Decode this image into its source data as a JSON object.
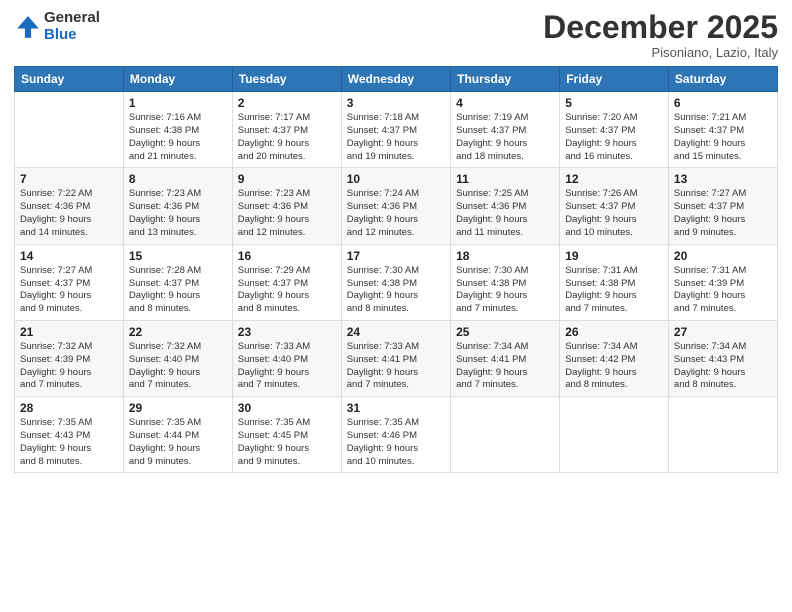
{
  "logo": {
    "general": "General",
    "blue": "Blue"
  },
  "title": "December 2025",
  "location": "Pisoniano, Lazio, Italy",
  "weekdays": [
    "Sunday",
    "Monday",
    "Tuesday",
    "Wednesday",
    "Thursday",
    "Friday",
    "Saturday"
  ],
  "weeks": [
    [
      {
        "day": "",
        "info": ""
      },
      {
        "day": "1",
        "info": "Sunrise: 7:16 AM\nSunset: 4:38 PM\nDaylight: 9 hours\nand 21 minutes."
      },
      {
        "day": "2",
        "info": "Sunrise: 7:17 AM\nSunset: 4:37 PM\nDaylight: 9 hours\nand 20 minutes."
      },
      {
        "day": "3",
        "info": "Sunrise: 7:18 AM\nSunset: 4:37 PM\nDaylight: 9 hours\nand 19 minutes."
      },
      {
        "day": "4",
        "info": "Sunrise: 7:19 AM\nSunset: 4:37 PM\nDaylight: 9 hours\nand 18 minutes."
      },
      {
        "day": "5",
        "info": "Sunrise: 7:20 AM\nSunset: 4:37 PM\nDaylight: 9 hours\nand 16 minutes."
      },
      {
        "day": "6",
        "info": "Sunrise: 7:21 AM\nSunset: 4:37 PM\nDaylight: 9 hours\nand 15 minutes."
      }
    ],
    [
      {
        "day": "7",
        "info": "Sunrise: 7:22 AM\nSunset: 4:36 PM\nDaylight: 9 hours\nand 14 minutes."
      },
      {
        "day": "8",
        "info": "Sunrise: 7:23 AM\nSunset: 4:36 PM\nDaylight: 9 hours\nand 13 minutes."
      },
      {
        "day": "9",
        "info": "Sunrise: 7:23 AM\nSunset: 4:36 PM\nDaylight: 9 hours\nand 12 minutes."
      },
      {
        "day": "10",
        "info": "Sunrise: 7:24 AM\nSunset: 4:36 PM\nDaylight: 9 hours\nand 12 minutes."
      },
      {
        "day": "11",
        "info": "Sunrise: 7:25 AM\nSunset: 4:36 PM\nDaylight: 9 hours\nand 11 minutes."
      },
      {
        "day": "12",
        "info": "Sunrise: 7:26 AM\nSunset: 4:37 PM\nDaylight: 9 hours\nand 10 minutes."
      },
      {
        "day": "13",
        "info": "Sunrise: 7:27 AM\nSunset: 4:37 PM\nDaylight: 9 hours\nand 9 minutes."
      }
    ],
    [
      {
        "day": "14",
        "info": "Sunrise: 7:27 AM\nSunset: 4:37 PM\nDaylight: 9 hours\nand 9 minutes."
      },
      {
        "day": "15",
        "info": "Sunrise: 7:28 AM\nSunset: 4:37 PM\nDaylight: 9 hours\nand 8 minutes."
      },
      {
        "day": "16",
        "info": "Sunrise: 7:29 AM\nSunset: 4:37 PM\nDaylight: 9 hours\nand 8 minutes."
      },
      {
        "day": "17",
        "info": "Sunrise: 7:30 AM\nSunset: 4:38 PM\nDaylight: 9 hours\nand 8 minutes."
      },
      {
        "day": "18",
        "info": "Sunrise: 7:30 AM\nSunset: 4:38 PM\nDaylight: 9 hours\nand 7 minutes."
      },
      {
        "day": "19",
        "info": "Sunrise: 7:31 AM\nSunset: 4:38 PM\nDaylight: 9 hours\nand 7 minutes."
      },
      {
        "day": "20",
        "info": "Sunrise: 7:31 AM\nSunset: 4:39 PM\nDaylight: 9 hours\nand 7 minutes."
      }
    ],
    [
      {
        "day": "21",
        "info": "Sunrise: 7:32 AM\nSunset: 4:39 PM\nDaylight: 9 hours\nand 7 minutes."
      },
      {
        "day": "22",
        "info": "Sunrise: 7:32 AM\nSunset: 4:40 PM\nDaylight: 9 hours\nand 7 minutes."
      },
      {
        "day": "23",
        "info": "Sunrise: 7:33 AM\nSunset: 4:40 PM\nDaylight: 9 hours\nand 7 minutes."
      },
      {
        "day": "24",
        "info": "Sunrise: 7:33 AM\nSunset: 4:41 PM\nDaylight: 9 hours\nand 7 minutes."
      },
      {
        "day": "25",
        "info": "Sunrise: 7:34 AM\nSunset: 4:41 PM\nDaylight: 9 hours\nand 7 minutes."
      },
      {
        "day": "26",
        "info": "Sunrise: 7:34 AM\nSunset: 4:42 PM\nDaylight: 9 hours\nand 8 minutes."
      },
      {
        "day": "27",
        "info": "Sunrise: 7:34 AM\nSunset: 4:43 PM\nDaylight: 9 hours\nand 8 minutes."
      }
    ],
    [
      {
        "day": "28",
        "info": "Sunrise: 7:35 AM\nSunset: 4:43 PM\nDaylight: 9 hours\nand 8 minutes."
      },
      {
        "day": "29",
        "info": "Sunrise: 7:35 AM\nSunset: 4:44 PM\nDaylight: 9 hours\nand 9 minutes."
      },
      {
        "day": "30",
        "info": "Sunrise: 7:35 AM\nSunset: 4:45 PM\nDaylight: 9 hours\nand 9 minutes."
      },
      {
        "day": "31",
        "info": "Sunrise: 7:35 AM\nSunset: 4:46 PM\nDaylight: 9 hours\nand 10 minutes."
      },
      {
        "day": "",
        "info": ""
      },
      {
        "day": "",
        "info": ""
      },
      {
        "day": "",
        "info": ""
      }
    ]
  ]
}
